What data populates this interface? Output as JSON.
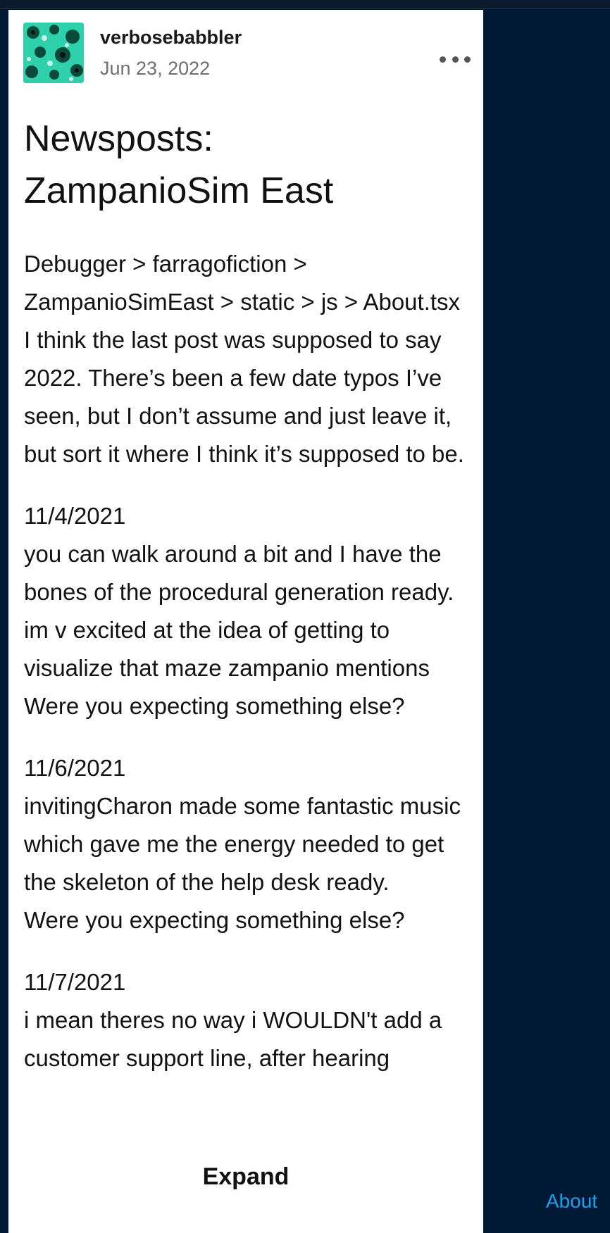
{
  "post": {
    "username": "verbosebabbler",
    "date": "Jun 23, 2022",
    "title_line1": "Newsposts:",
    "title_line2": "ZampanioSim East",
    "paragraphs": [
      [
        "Debugger > farragofiction > ZampanioSimEast > static > js > About.tsx",
        "I think the last post was supposed to say 2022. There’s been a few date typos I’ve seen, but I don’t assume and just leave it, but sort it where I think it’s supposed to be."
      ],
      [
        "11/4/2021",
        "you can walk around a bit and I have the bones of the procedural generation ready. im v excited at the idea of getting to visualize that maze zampanio mentions",
        "Were you expecting something else?"
      ],
      [
        "11/6/2021",
        "invitingCharon made some fantastic music which gave me the energy needed to get the skeleton of the help desk ready.",
        "Were you expecting something else?"
      ],
      [
        "11/7/2021",
        "i mean theres no way i WOULDN't add a customer support line, after hearing"
      ]
    ],
    "expand_label": "Expand"
  },
  "footer": {
    "about_label": "About"
  },
  "icons": {
    "more": "more-options-icon",
    "avatar": "avatar-image"
  }
}
